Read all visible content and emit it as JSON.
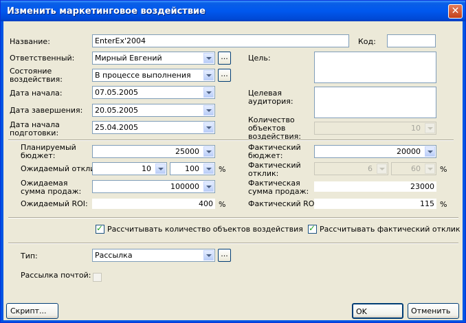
{
  "window": {
    "title": "Изменить маркетинговое воздействие",
    "close_glyph": "✕"
  },
  "form": {
    "name": {
      "label": "Название:",
      "value": "EnterEx'2004"
    },
    "code": {
      "label": "Код:",
      "value": ""
    },
    "responsible": {
      "label": "Ответственный:",
      "value": "Мирный Евгений"
    },
    "goal": {
      "label": "Цель:",
      "value": ""
    },
    "state": {
      "label": "Состояние воздействия:",
      "value": "В процессе выполнения"
    },
    "start_date": {
      "label": "Дата начала:",
      "value": "07.05.2005"
    },
    "target_audience": {
      "label": "Целевая аудитория:",
      "value": ""
    },
    "end_date": {
      "label": "Дата завершения:",
      "value": "20.05.2005"
    },
    "prep_start": {
      "label": "Дата начала подготовки:",
      "value": "25.04.2005"
    },
    "objects_count": {
      "label": "Количество объектов воздействия:",
      "value": "10"
    },
    "planned_budget": {
      "label": "Планируемый бюджет:",
      "value": "25000"
    },
    "actual_budget": {
      "label": "Фактический бюджет:",
      "value": "20000"
    },
    "expected_response": {
      "label": "Ожидаемый отклик:",
      "value1": "10",
      "value2": "100",
      "unit": "%"
    },
    "actual_response": {
      "label": "Фактический отклик:",
      "value1": "6",
      "value2": "60",
      "unit": "%"
    },
    "expected_sales": {
      "label": "Ожидаемая сумма продаж:",
      "value": "100000"
    },
    "actual_sales": {
      "label": "Фактическая сумма продаж:",
      "value": "23000"
    },
    "expected_roi": {
      "label": "Ожидаемый ROI:",
      "value": "400",
      "unit": "%"
    },
    "actual_roi": {
      "label": "Фактический ROI:",
      "value": "115",
      "unit": "%"
    },
    "calc_objects": {
      "label": "Рассчитывать количество объектов воздействия",
      "checked": true
    },
    "calc_response": {
      "label": "Рассчитывать фактический отклик",
      "checked": true
    },
    "type": {
      "label": "Тип:",
      "value": "Рассылка"
    },
    "mail_delivery": {
      "label": "Рассылка почтой:",
      "checked": false
    },
    "ellipsis": "..."
  },
  "buttons": {
    "script": "Скрипт...",
    "ok": "OK",
    "cancel": "Отменить"
  }
}
